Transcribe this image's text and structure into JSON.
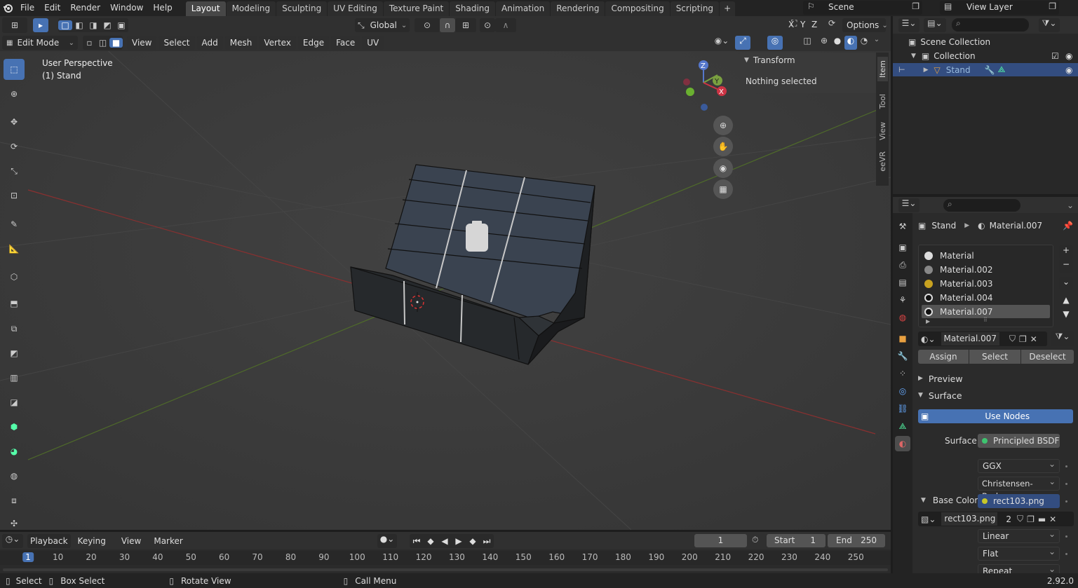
{
  "version": "2.92.0",
  "menus": [
    "File",
    "Edit",
    "Render",
    "Window",
    "Help"
  ],
  "workspaces": [
    "Layout",
    "Modeling",
    "Sculpting",
    "UV Editing",
    "Texture Paint",
    "Shading",
    "Animation",
    "Rendering",
    "Compositing",
    "Scripting"
  ],
  "scene": "Scene",
  "view_layer": "View Layer",
  "header": {
    "orientation": "Global",
    "axes": [
      "X",
      "Y",
      "Z"
    ],
    "options": "Options"
  },
  "editor_header": {
    "mode": "Edit Mode",
    "menus": [
      "View",
      "Select",
      "Add",
      "Mesh",
      "Vertex",
      "Edge",
      "Face",
      "UV"
    ]
  },
  "viewport": {
    "perspective": "User Perspective",
    "object": "(1) Stand"
  },
  "npanel": {
    "title": "Transform",
    "message": "Nothing selected",
    "tabs": [
      "Item",
      "Tool",
      "View",
      "eeVR"
    ]
  },
  "outliner": {
    "scene_collection": "Scene Collection",
    "collection": "Collection",
    "object": "Stand"
  },
  "properties": {
    "breadcrumb_object": "Stand",
    "breadcrumb_material": "Material.007",
    "materials": [
      "Material",
      "Material.002",
      "Material.003",
      "Material.004",
      "Material.007"
    ],
    "material_field": "Material.007",
    "assign": "Assign",
    "select": "Select",
    "deselect": "Deselect",
    "preview": "Preview",
    "surface_panel": "Surface",
    "use_nodes": "Use Nodes",
    "surface_label": "Surface",
    "surface_value": "Principled BSDF",
    "distribution": "GGX",
    "subsurface": "Christensen-Burley",
    "base_color_label": "Base Color",
    "base_color_value": "rect103.png",
    "image_name": "rect103.png",
    "image_users": "2",
    "interpolation": "Linear",
    "projection": "Flat",
    "extension": "Repeat"
  },
  "timeline": {
    "menus": [
      "Playback",
      "Keying",
      "View",
      "Marker"
    ],
    "current_frame": "1",
    "start_label": "Start",
    "start": "1",
    "end_label": "End",
    "end": "250",
    "ruler": [
      "1",
      "10",
      "20",
      "30",
      "40",
      "50",
      "60",
      "70",
      "80",
      "90",
      "100",
      "110",
      "120",
      "130",
      "140",
      "150",
      "160",
      "170",
      "180",
      "190",
      "200",
      "210",
      "220",
      "230",
      "240",
      "250"
    ]
  },
  "status": {
    "select": "Select",
    "box_select": "Box Select",
    "rotate": "Rotate View",
    "call_menu": "Call Menu"
  },
  "gizmo": {
    "x": "X",
    "y": "Y",
    "z": "Z"
  }
}
